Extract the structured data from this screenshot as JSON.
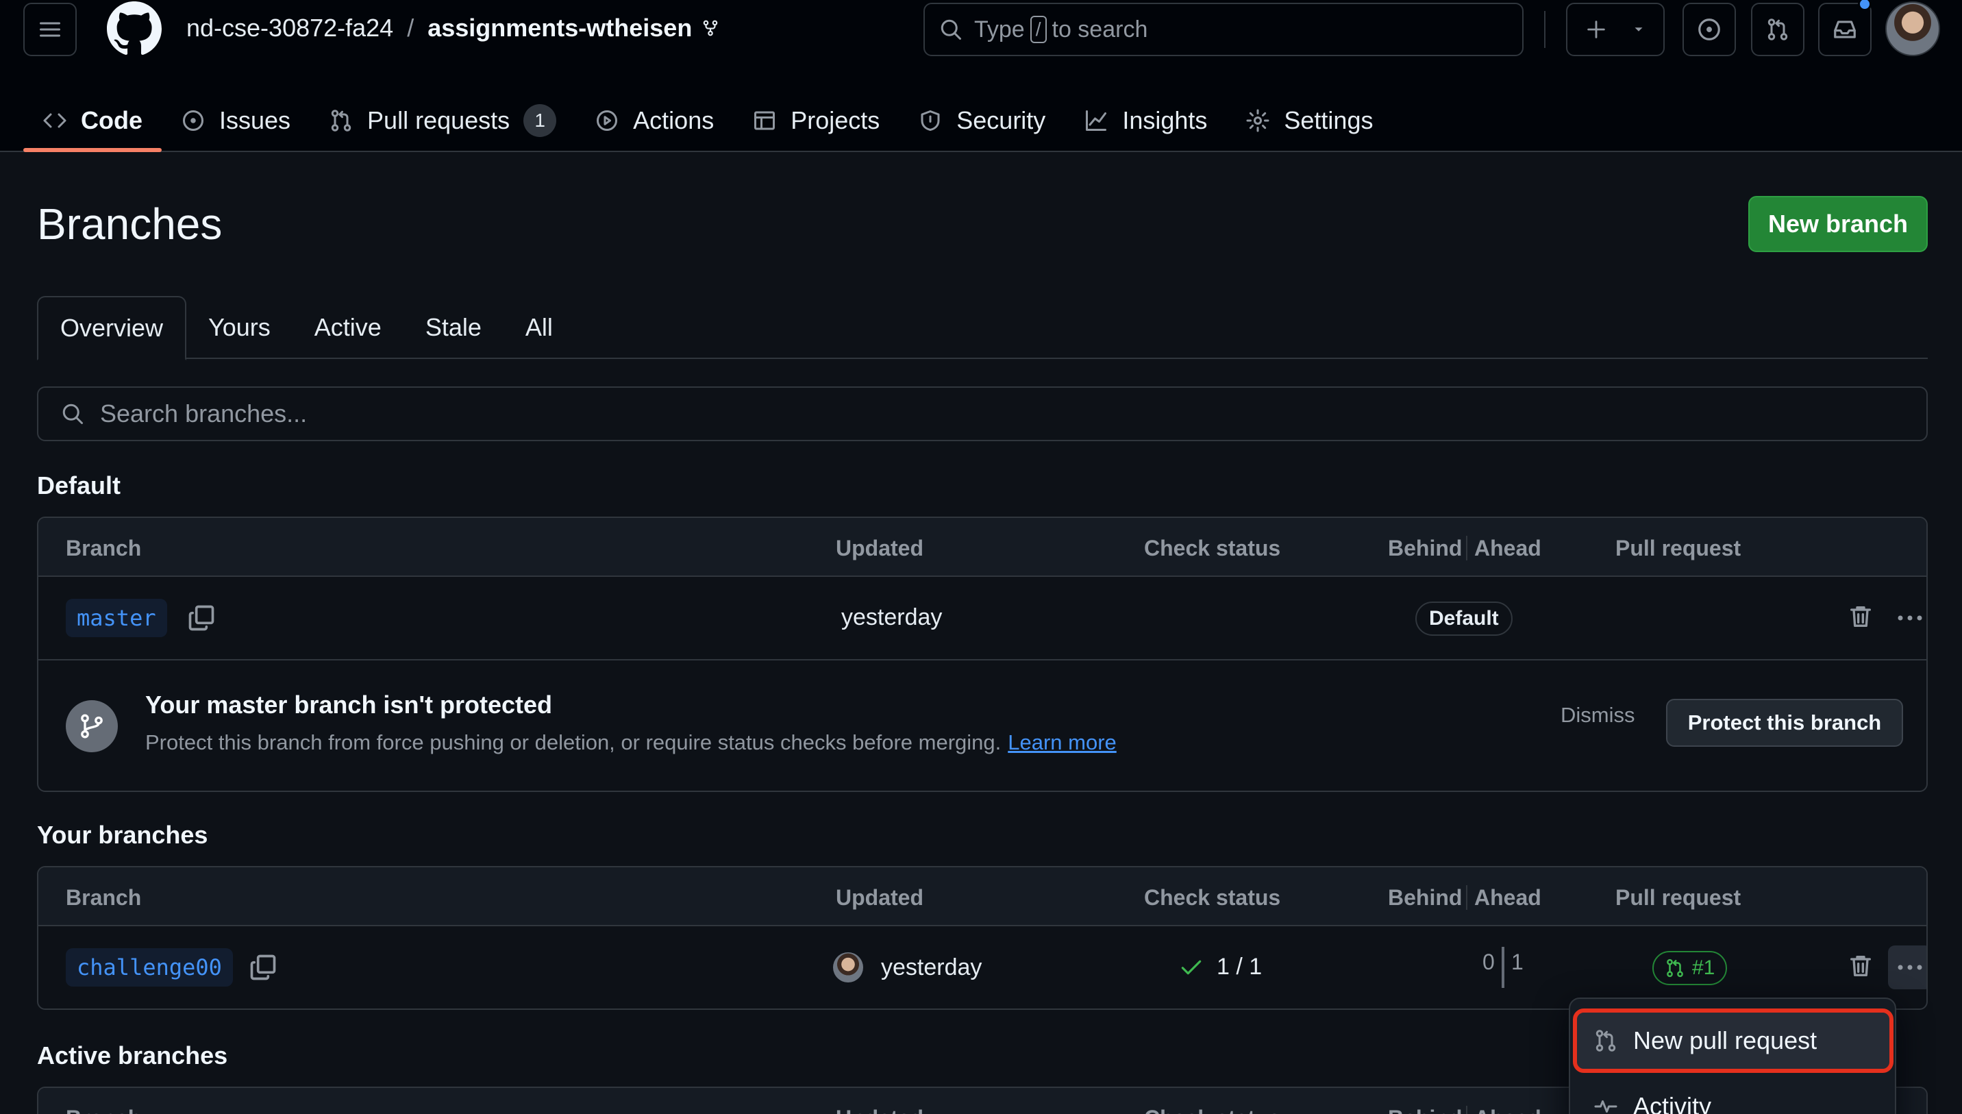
{
  "header": {
    "repo_owner": "nd-cse-30872-fa24",
    "repo_separator": "/",
    "repo_name": "assignments-wtheisen",
    "search": {
      "prefix": "Type",
      "key": "/",
      "suffix": "to search"
    },
    "icons": [
      "hamburger-icon",
      "github-logo-icon",
      "fork-icon",
      "search-icon",
      "plus-icon",
      "triangle-down-icon",
      "issue-icon",
      "pull-request-icon",
      "inbox-icon"
    ],
    "notification_dot_color": "#4493f8"
  },
  "repo_nav": {
    "tabs": [
      {
        "label": "Code",
        "icon": "code-icon",
        "active": true
      },
      {
        "label": "Issues",
        "icon": "issue-opened-icon"
      },
      {
        "label": "Pull requests",
        "icon": "git-pull-request-icon",
        "count": "1"
      },
      {
        "label": "Actions",
        "icon": "play-icon"
      },
      {
        "label": "Projects",
        "icon": "table-icon"
      },
      {
        "label": "Security",
        "icon": "shield-icon"
      },
      {
        "label": "Insights",
        "icon": "graph-icon"
      },
      {
        "label": "Settings",
        "icon": "gear-icon"
      }
    ],
    "active_underline_color": "#f78166"
  },
  "page": {
    "title": "Branches",
    "new_branch_label": "New branch",
    "new_branch_color": "#238636",
    "subtabs": [
      "Overview",
      "Yours",
      "Active",
      "Stale",
      "All"
    ],
    "active_subtab": "Overview",
    "search_placeholder": "Search branches..."
  },
  "columns": {
    "branch": "Branch",
    "updated": "Updated",
    "check_status": "Check status",
    "behind": "Behind",
    "ahead": "Ahead",
    "pull_request": "Pull request"
  },
  "default_section": {
    "heading": "Default",
    "row": {
      "branch": "master",
      "updated": "yesterday",
      "badge": "Default"
    },
    "banner": {
      "title": "Your master branch isn't protected",
      "description": "Protect this branch from force pushing or deletion, or require status checks before merging.",
      "link": "Learn more",
      "dismiss": "Dismiss",
      "protect_button": "Protect this branch"
    }
  },
  "your_section": {
    "heading": "Your branches",
    "row": {
      "branch": "challenge00",
      "updated": "yesterday",
      "check": "1 / 1",
      "check_color": "#3fb950",
      "behind": "0",
      "ahead": "1",
      "pr": "#1"
    }
  },
  "active_section": {
    "heading": "Active branches"
  },
  "dropdown": {
    "items": [
      {
        "label": "New pull request",
        "icon": "git-pull-request-icon",
        "highlighted": true
      },
      {
        "label": "Activity",
        "icon": "pulse-icon"
      }
    ],
    "highlight_color": "#e5301d"
  }
}
